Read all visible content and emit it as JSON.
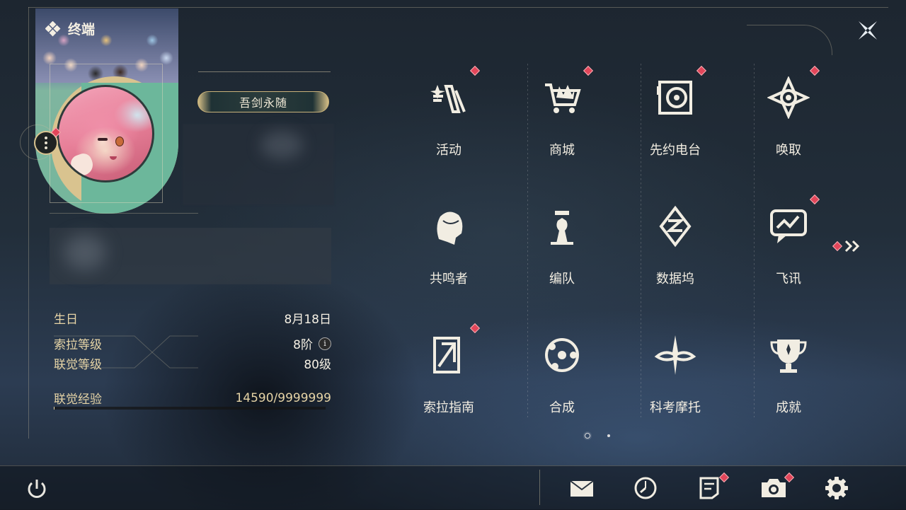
{
  "header": {
    "title": "终端",
    "close_icon": "close-icon"
  },
  "profile": {
    "title_badge": "吾剑永随",
    "fields": [
      {
        "label": "生日",
        "value": "8月18日"
      },
      {
        "label": "索拉等级",
        "value": "8阶"
      },
      {
        "label": "联觉等级",
        "value": "80级"
      },
      {
        "label": "联觉经验",
        "value": "14590/9999999"
      }
    ],
    "exp_fraction": 0.0015
  },
  "menu": {
    "items": [
      {
        "label": "活动",
        "icon": "event-icon",
        "badge": true
      },
      {
        "label": "商城",
        "icon": "shop-crown-cart-icon",
        "badge": true
      },
      {
        "label": "先约电台",
        "icon": "radio-pass-icon",
        "badge": true
      },
      {
        "label": "唤取",
        "icon": "convene-star-icon",
        "badge": true
      },
      {
        "label": "共鸣者",
        "icon": "resonator-portrait-icon",
        "badge": false
      },
      {
        "label": "编队",
        "icon": "team-chess-icon",
        "badge": false
      },
      {
        "label": "数据坞",
        "icon": "data-bank-icon",
        "badge": false
      },
      {
        "label": "飞讯",
        "icon": "message-bubble-icon",
        "badge": true
      },
      {
        "label": "索拉指南",
        "icon": "guidebook-icon",
        "badge": true
      },
      {
        "label": "合成",
        "icon": "synthesis-icon",
        "badge": false
      },
      {
        "label": "科考摩托",
        "icon": "motorbike-icon",
        "badge": false
      },
      {
        "label": "成就",
        "icon": "trophy-icon",
        "badge": false
      }
    ],
    "pages": 2,
    "current_page": 1
  },
  "bottom_bar": {
    "power_icon": "power-icon",
    "icons": [
      "mail-icon",
      "clock-icon",
      "notice-icon",
      "camera-icon",
      "settings-gear-icon"
    ]
  },
  "colors": {
    "accent_gold": "#d9c38f",
    "badge_red": "#e2465a",
    "text_light": "#f3eee2"
  }
}
